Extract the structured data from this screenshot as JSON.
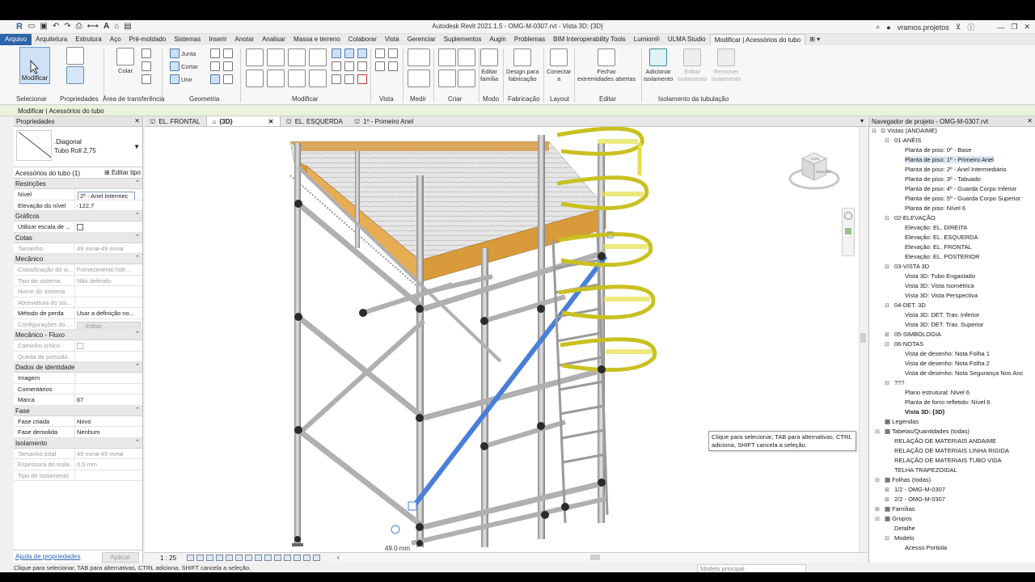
{
  "window": {
    "title": "Autodesk Revit 2021.1.5 - OMG-M-0307.rvt - Vista 3D: {3D}",
    "user": "vramos.projetos",
    "app_letter": "R"
  },
  "menu": {
    "tabs": [
      "Arquivo",
      "Arquitetura",
      "Estrutura",
      "Aço",
      "Pré-moldado",
      "Sistemas",
      "Inserir",
      "Anotar",
      "Analisar",
      "Massa e terreno",
      "Colaborar",
      "Vista",
      "Gerenciar",
      "Suplementos",
      "Augin",
      "Problemas",
      "BIM Interoperability Tools",
      "Lumion®",
      "ULMA Studio",
      "Modificar | Acessórios do tubo"
    ]
  },
  "ribbon": {
    "modify": "Modificar",
    "colar": "Colar",
    "junta": "Junta",
    "cortar": "Cortar",
    "unir": "Unir",
    "editar_familia": [
      "Editar",
      "família"
    ],
    "design_fabricacao": [
      "Design para",
      "fabricação"
    ],
    "conectar": [
      "Conectar",
      "a"
    ],
    "fechar": [
      "Fechar",
      "extremidades abertas"
    ],
    "adicionar_isol": [
      "Adicionar",
      "isolamento"
    ],
    "editar_isol": [
      "Editar",
      "isolamento"
    ],
    "remover_isol": [
      "Remover",
      "isolamento"
    ],
    "panels": {
      "selecionar": "Selecionar",
      "propriedades": "Propriedades",
      "area_transf": "Área de transferência",
      "geometria": "Geometria",
      "modificar": "Modificar",
      "vista": "Vista",
      "medir": "Medir",
      "criar": "Criar",
      "modo": "Modo",
      "fabricacao": "Fabricação",
      "layout": "Layout",
      "editar": "Editar",
      "isolamento_tub": "Isolamento da tubulação"
    }
  },
  "context_bar": "Modificar | Acessórios do tubo",
  "properties": {
    "header": "Propriedades",
    "type_line1": ".Diagonal",
    "type_line2": "Tubo Roll 2,75",
    "instance_filter": "Acessórios do tubo (1)",
    "edit_type": "Editar tipo",
    "groups": [
      {
        "name": "Restrições",
        "rows": [
          {
            "k": "Nível",
            "v": "2º - Anel Intermec",
            "kind": "input"
          },
          {
            "k": "Elevação do nível",
            "v": "-122,7"
          }
        ]
      },
      {
        "name": "Gráficos",
        "rows": [
          {
            "k": "Utilizar escala de ...",
            "v": "",
            "kind": "check"
          }
        ]
      },
      {
        "name": "Cotas",
        "rows": [
          {
            "k": "Tamanho",
            "v": "49 mmø-49 mmø",
            "dis": true
          }
        ]
      },
      {
        "name": "Mecânico",
        "rows": [
          {
            "k": "Classificação do si...",
            "v": "Fornecimento hidr...",
            "dis": true
          },
          {
            "k": "Tipo de sistema",
            "v": "Não definido",
            "dis": true
          },
          {
            "k": "Nome do sistema",
            "v": "",
            "dis": true
          },
          {
            "k": "Abreviatura do sis...",
            "v": "",
            "dis": true
          },
          {
            "k": "Método de perda",
            "v": "Usar a definição no..."
          },
          {
            "k": "Configurações do ...",
            "v": "Editar...",
            "dis": true,
            "kind": "button"
          }
        ]
      },
      {
        "name": "Mecânico - Fluxo",
        "rows": [
          {
            "k": "Caminho crítico",
            "v": "",
            "dis": true,
            "kind": "checkdis"
          },
          {
            "k": "Queda de pressão",
            "v": "",
            "dis": true
          }
        ]
      },
      {
        "name": "Dados de identidade",
        "rows": [
          {
            "k": "Imagem",
            "v": ""
          },
          {
            "k": "Comentários",
            "v": ""
          },
          {
            "k": "Marca",
            "v": "67"
          }
        ]
      },
      {
        "name": "Fase",
        "rows": [
          {
            "k": "Fase criada",
            "v": "Novo"
          },
          {
            "k": "Fase demolida",
            "v": "Nenhum"
          }
        ]
      },
      {
        "name": "Isolamento",
        "rows": [
          {
            "k": "Tamanho total",
            "v": "49 mmø-49 mmø",
            "dis": true
          },
          {
            "k": "Espessura do isola...",
            "v": "0,0 mm",
            "dis": true
          },
          {
            "k": "Tipo de isolamento",
            "v": "",
            "dis": true
          }
        ]
      }
    ],
    "help_link": "Ajuda de propriedades",
    "apply": "Aplicar"
  },
  "view_tabs": [
    {
      "label": "EL. FRONTAL",
      "active": false
    },
    {
      "label": "{3D}",
      "active": true
    },
    {
      "label": "EL. ESQUERDA",
      "active": false
    },
    {
      "label": "1º - Primeiro Anel",
      "active": false
    }
  ],
  "viewcube": {
    "top": "TOPO",
    "front": "FRONTAL"
  },
  "canvas": {
    "dimension": "49.0 mm"
  },
  "tooltip": "Clique para selecionar, TAB para alternativas, CTRL adiciona, SHIFT cancela a seleção.",
  "view_control": {
    "scale": "1 : 25"
  },
  "browser": {
    "header": "Navegador de projeto - OMG-M-0307.rvt",
    "views_root": "Vistas (ANDAIME)",
    "items": [
      {
        "t": "01-ANÉIS",
        "lvl": 1,
        "toggle": "-"
      },
      {
        "t": "Planta de piso: 0º - Base",
        "lvl": 2
      },
      {
        "t": "Planta de piso: 1º - Primeiro Anel",
        "lvl": 2,
        "sel": true
      },
      {
        "t": "Planta de piso: 2º - Anel Intermediário",
        "lvl": 2
      },
      {
        "t": "Planta de piso: 3º - Tabuado",
        "lvl": 2
      },
      {
        "t": "Planta de piso: 4º - Guarda Corpo Inferior",
        "lvl": 2
      },
      {
        "t": "Planta de piso: 5º - Guarda Corpo Superior",
        "lvl": 2
      },
      {
        "t": "Planta de piso: Nível 6",
        "lvl": 2
      },
      {
        "t": "02-ELEVAÇÃO",
        "lvl": 1,
        "toggle": "-"
      },
      {
        "t": "Elevação: EL. DIREITA",
        "lvl": 2
      },
      {
        "t": "Elevação: EL. ESQUERDA",
        "lvl": 2
      },
      {
        "t": "Elevação: EL. FRONTAL",
        "lvl": 2
      },
      {
        "t": "Elevação: EL. POSTERIOR",
        "lvl": 2
      },
      {
        "t": "03-VISTA 3D",
        "lvl": 1,
        "toggle": "-"
      },
      {
        "t": "Vista 3D: Tubo Engastado",
        "lvl": 2
      },
      {
        "t": "Vista 3D: Vista Isométrica",
        "lvl": 2
      },
      {
        "t": "Vista 3D: Vista Perspectiva",
        "lvl": 2
      },
      {
        "t": "04-DET. 3D",
        "lvl": 1,
        "toggle": "-"
      },
      {
        "t": "Vista 3D: DET. Trav. Inferior",
        "lvl": 2
      },
      {
        "t": "Vista 3D: DET. Trav. Superior",
        "lvl": 2
      },
      {
        "t": "05-SIMBOLOGIA",
        "lvl": 1,
        "toggle": "+"
      },
      {
        "t": "06-NOTAS",
        "lvl": 1,
        "toggle": "-"
      },
      {
        "t": "Vista de desenho: Nota Folha 1",
        "lvl": 2
      },
      {
        "t": "Vista de desenho: Nota Folha 2",
        "lvl": 2
      },
      {
        "t": "Vista de desenho: Nota Segurança Nos Anc",
        "lvl": 2
      },
      {
        "t": "???",
        "lvl": 1,
        "toggle": "-"
      },
      {
        "t": "Plano estrutural: Nível 6",
        "lvl": 2
      },
      {
        "t": "Planta de forro refletido: Nível 6",
        "lvl": 2
      },
      {
        "t": "Vista 3D: {3D}",
        "lvl": 2,
        "bold": true
      },
      {
        "t": "Legendas",
        "lvl": 0,
        "icon": true
      },
      {
        "t": "Tabelas/Quantidades (todas)",
        "lvl": 0,
        "icon": true,
        "toggle": "-"
      },
      {
        "t": "RELAÇÃO DE MATERIAIS ANDAIME",
        "lvl": 1
      },
      {
        "t": "RELAÇÃO DE MATERIAIS LINHA RIGIDA",
        "lvl": 1
      },
      {
        "t": "RELAÇÃO DE MATERIAIS TUBO VIDA",
        "lvl": 1
      },
      {
        "t": "TELHA TRAPEZOIDAL",
        "lvl": 1
      },
      {
        "t": "Folhas (todas)",
        "lvl": 0,
        "icon": true,
        "toggle": "-"
      },
      {
        "t": "1/2 - OMG-M-0307",
        "lvl": 1,
        "toggle": "+"
      },
      {
        "t": "2/2 - OMG-M-0307",
        "lvl": 1,
        "toggle": "+"
      },
      {
        "t": "Famílias",
        "lvl": 0,
        "icon": true,
        "toggle": "+"
      },
      {
        "t": "Grupos",
        "lvl": 0,
        "icon": true,
        "toggle": "-"
      },
      {
        "t": "Detalhe",
        "lvl": 1
      },
      {
        "t": "Modelo",
        "lvl": 1,
        "toggle": "-"
      },
      {
        "t": "Acesso Portiola",
        "lvl": 2
      }
    ]
  },
  "status": {
    "text": "Clique para selecionar, TAB para alternativas, CTRL adiciona, SHIFT cancela a seleção.",
    "model": "Modelo principal"
  },
  "colors": {
    "accent": "#2c64a8",
    "context": "#e9f2dc",
    "selected_pipe": "#4a7fd9",
    "deck": "#d99a3c",
    "cage": "#e5e04a"
  }
}
